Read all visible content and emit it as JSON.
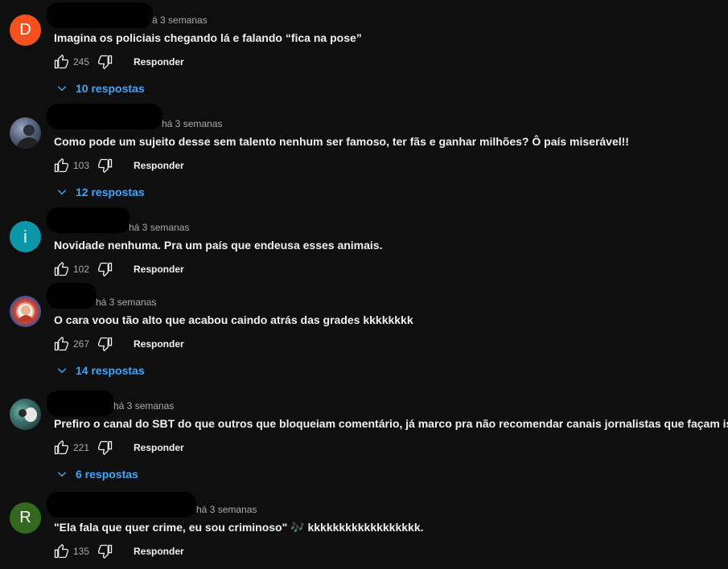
{
  "colors": {
    "background": "#0f0f0f",
    "link_blue": "#3ea6ff",
    "text_secondary": "#aaaaaa"
  },
  "reply_label": "Responder",
  "comments": [
    {
      "avatar_letter": "D",
      "avatar_color": "#f4511e",
      "time": "á 3 semanas",
      "text": "Imagina os policiais chegando lá e falando “fica na pose”",
      "likes": "245",
      "replies": "10 respostas"
    },
    {
      "avatar_letter": "",
      "avatar_icon": "profile-photo",
      "time": "há 3 semanas",
      "text": "Como pode um sujeito desse sem talento nenhum ser famoso, ter fãs e ganhar milhões? Ô país miserável!!",
      "likes": "103",
      "replies": "12 respostas"
    },
    {
      "avatar_letter": "i",
      "avatar_color": "#0b96a8",
      "time": "há 3 semanas",
      "text": "Novidade nenhuma. Pra um país que endeusa esses animais.",
      "likes": "102",
      "replies": ""
    },
    {
      "avatar_letter": "",
      "avatar_icon": "profile-photo",
      "time": "há 3 semanas",
      "text": "O cara voou tão alto que acabou caindo atrás das grades kkkkkkkk",
      "likes": "267",
      "replies": "14 respostas"
    },
    {
      "avatar_letter": "",
      "avatar_icon": "profile-photo",
      "time": "há 3 semanas",
      "text": "Prefiro o canal do SBT do que outros que bloqueiam comentário, já marco pra não recomendar canais jornalistas que façam isso...",
      "likes": "221",
      "replies": "6 respostas"
    },
    {
      "avatar_letter": "R",
      "avatar_color": "#33691e",
      "time": "há 3 semanas",
      "text": "\"Ela fala que quer crime, eu sou criminoso\" 🎶 kkkkkkkkkkkkkkkkkk.",
      "likes": "135",
      "replies": ""
    }
  ]
}
